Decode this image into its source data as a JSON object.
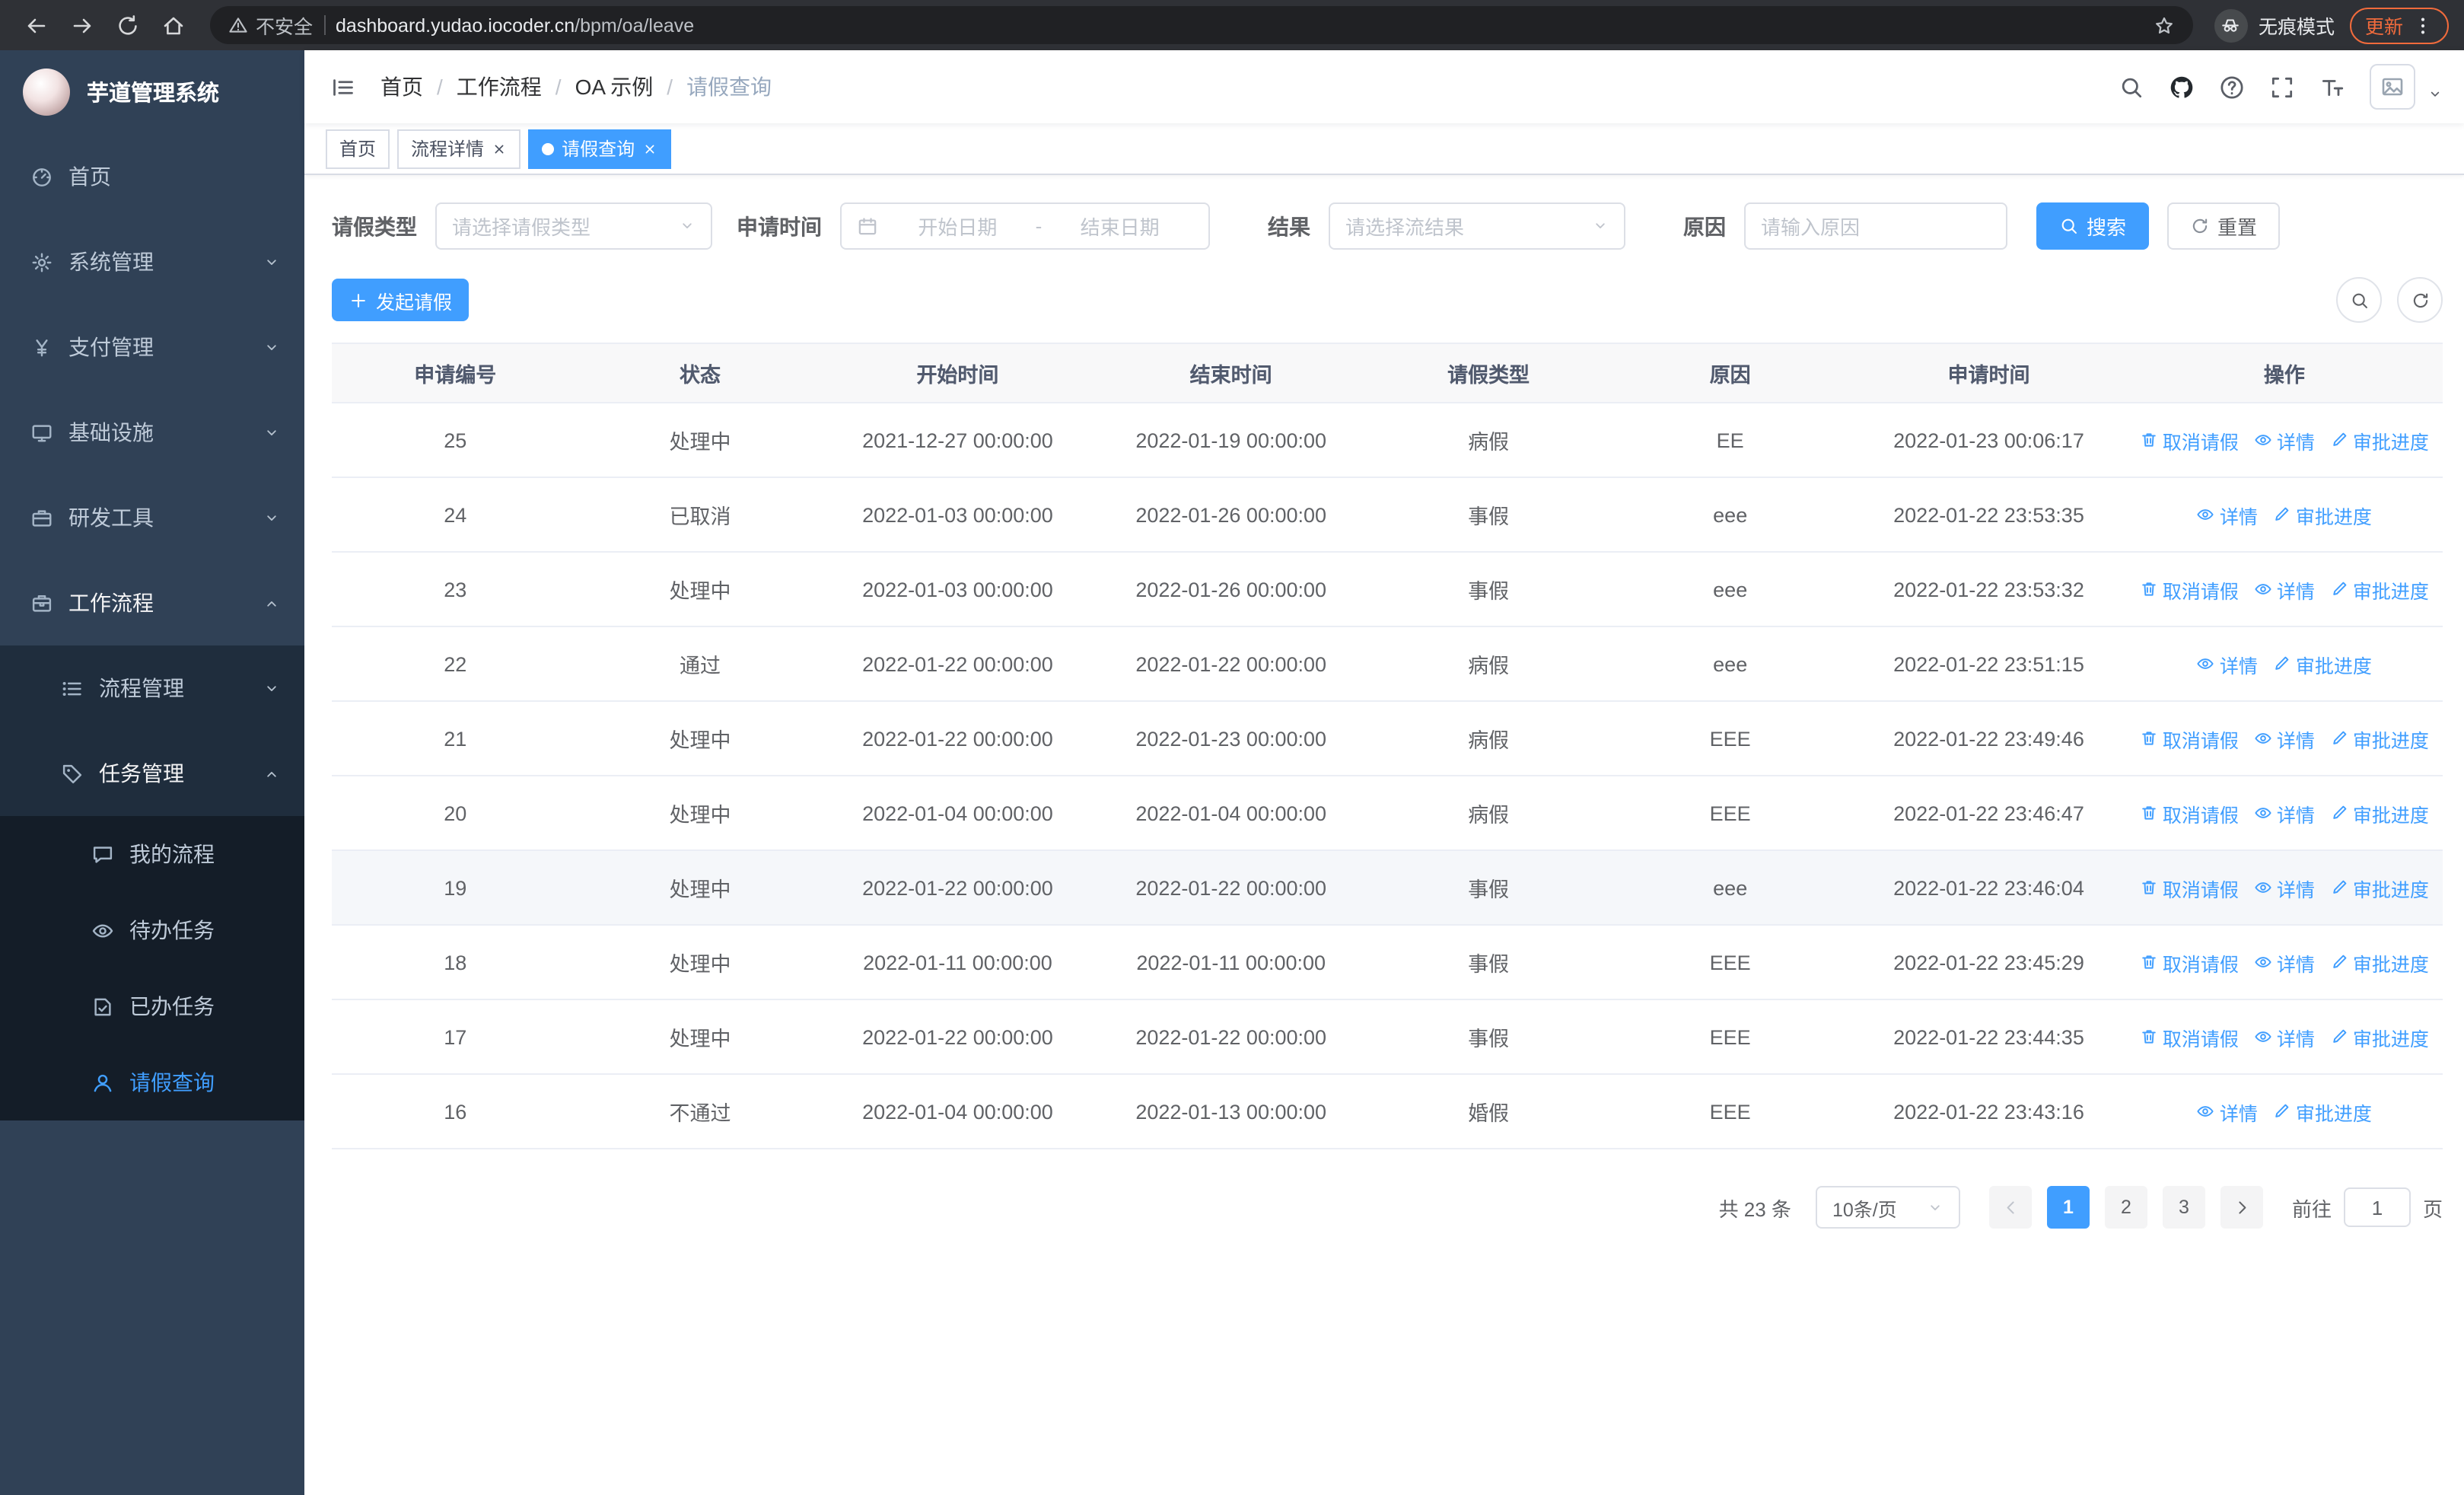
{
  "colors": {
    "primary": "#409EFF",
    "update_chip": "#f16b3c"
  },
  "browser": {
    "security_label": "不安全",
    "url_host": "dashboard.yudao.iocoder.cn",
    "url_path": "/bpm/oa/leave",
    "incognito_label": "无痕模式",
    "update_label": "更新"
  },
  "sidebar": {
    "logo_title": "芋道管理系统",
    "menu": [
      {
        "key": "home",
        "label": "首页",
        "icon": "dashboard"
      },
      {
        "key": "system",
        "label": "系统管理",
        "icon": "gear",
        "arrow": "down"
      },
      {
        "key": "payment",
        "label": "支付管理",
        "icon": "yen",
        "arrow": "down"
      },
      {
        "key": "infrastructure",
        "label": "基础设施",
        "icon": "monitor",
        "arrow": "down"
      },
      {
        "key": "devtools",
        "label": "研发工具",
        "icon": "briefcase",
        "arrow": "down"
      },
      {
        "key": "workflow",
        "label": "工作流程",
        "icon": "suitcase",
        "arrow": "up",
        "open": true,
        "children": [
          {
            "key": "process-mgmt",
            "label": "流程管理",
            "icon": "list",
            "arrow": "down"
          },
          {
            "key": "task-mgmt",
            "label": "任务管理",
            "icon": "tag",
            "arrow": "up",
            "open": true,
            "children": [
              {
                "key": "my-process",
                "label": "我的流程",
                "icon": "chat"
              },
              {
                "key": "todo-task",
                "label": "待办任务",
                "icon": "eye"
              },
              {
                "key": "done-task",
                "label": "已办任务",
                "icon": "finished"
              },
              {
                "key": "leave-query",
                "label": "请假查询",
                "icon": "user",
                "active": true
              }
            ]
          }
        ]
      }
    ]
  },
  "header": {
    "breadcrumb": [
      "首页",
      "工作流程",
      "OA 示例",
      "请假查询"
    ],
    "icons": [
      "search",
      "github",
      "question",
      "fullscreen",
      "fontsize",
      "avatar"
    ]
  },
  "tabs": [
    {
      "key": "home",
      "label": "首页",
      "closable": false,
      "active": false
    },
    {
      "key": "process-detail",
      "label": "流程详情",
      "closable": true,
      "active": false
    },
    {
      "key": "leave-query",
      "label": "请假查询",
      "closable": true,
      "active": true
    }
  ],
  "filters": {
    "leave_type": {
      "label": "请假类型",
      "placeholder": "请选择请假类型"
    },
    "apply_time": {
      "label": "申请时间",
      "start_placeholder": "开始日期",
      "separator": "-",
      "end_placeholder": "结束日期"
    },
    "result": {
      "label": "结果",
      "placeholder": "请选择流结果"
    },
    "reason": {
      "label": "原因",
      "placeholder": "请输入原因"
    },
    "search_label": "搜索",
    "reset_label": "重置"
  },
  "toolbar": {
    "create_label": "发起请假"
  },
  "table": {
    "columns": [
      "申请编号",
      "状态",
      "开始时间",
      "结束时间",
      "请假类型",
      "原因",
      "申请时间",
      "操作"
    ],
    "actions": {
      "cancel": {
        "label": "取消请假",
        "icon": "delete"
      },
      "detail": {
        "label": "详情",
        "icon": "view"
      },
      "progress": {
        "label": "审批进度",
        "icon": "edit"
      }
    },
    "rows": [
      {
        "id": "25",
        "status": "处理中",
        "start": "2021-12-27 00:00:00",
        "end": "2022-01-19 00:00:00",
        "type": "病假",
        "reason": "EE",
        "apply_time": "2022-01-23 00:06:17",
        "actions": [
          "cancel",
          "detail",
          "progress"
        ]
      },
      {
        "id": "24",
        "status": "已取消",
        "start": "2022-01-03 00:00:00",
        "end": "2022-01-26 00:00:00",
        "type": "事假",
        "reason": "eee",
        "apply_time": "2022-01-22 23:53:35",
        "actions": [
          "detail",
          "progress"
        ]
      },
      {
        "id": "23",
        "status": "处理中",
        "start": "2022-01-03 00:00:00",
        "end": "2022-01-26 00:00:00",
        "type": "事假",
        "reason": "eee",
        "apply_time": "2022-01-22 23:53:32",
        "actions": [
          "cancel",
          "detail",
          "progress"
        ]
      },
      {
        "id": "22",
        "status": "通过",
        "start": "2022-01-22 00:00:00",
        "end": "2022-01-22 00:00:00",
        "type": "病假",
        "reason": "eee",
        "apply_time": "2022-01-22 23:51:15",
        "actions": [
          "detail",
          "progress"
        ]
      },
      {
        "id": "21",
        "status": "处理中",
        "start": "2022-01-22 00:00:00",
        "end": "2022-01-23 00:00:00",
        "type": "病假",
        "reason": "EEE",
        "apply_time": "2022-01-22 23:49:46",
        "actions": [
          "cancel",
          "detail",
          "progress"
        ]
      },
      {
        "id": "20",
        "status": "处理中",
        "start": "2022-01-04 00:00:00",
        "end": "2022-01-04 00:00:00",
        "type": "病假",
        "reason": "EEE",
        "apply_time": "2022-01-22 23:46:47",
        "actions": [
          "cancel",
          "detail",
          "progress"
        ]
      },
      {
        "id": "19",
        "status": "处理中",
        "start": "2022-01-22 00:00:00",
        "end": "2022-01-22 00:00:00",
        "type": "事假",
        "reason": "eee",
        "apply_time": "2022-01-22 23:46:04",
        "actions": [
          "cancel",
          "detail",
          "progress"
        ],
        "highlighted": true
      },
      {
        "id": "18",
        "status": "处理中",
        "start": "2022-01-11 00:00:00",
        "end": "2022-01-11 00:00:00",
        "type": "事假",
        "reason": "EEE",
        "apply_time": "2022-01-22 23:45:29",
        "actions": [
          "cancel",
          "detail",
          "progress"
        ]
      },
      {
        "id": "17",
        "status": "处理中",
        "start": "2022-01-22 00:00:00",
        "end": "2022-01-22 00:00:00",
        "type": "事假",
        "reason": "EEE",
        "apply_time": "2022-01-22 23:44:35",
        "actions": [
          "cancel",
          "detail",
          "progress"
        ]
      },
      {
        "id": "16",
        "status": "不通过",
        "start": "2022-01-04 00:00:00",
        "end": "2022-01-13 00:00:00",
        "type": "婚假",
        "reason": "EEE",
        "apply_time": "2022-01-22 23:43:16",
        "actions": [
          "detail",
          "progress"
        ]
      }
    ]
  },
  "pagination": {
    "total_text": "共 23 条",
    "page_size_value": "10条/页",
    "pages": [
      "1",
      "2",
      "3"
    ],
    "active_page": "1",
    "prev_disabled": true,
    "goto_label": "前往",
    "goto_value": "1",
    "page_unit": "页"
  }
}
